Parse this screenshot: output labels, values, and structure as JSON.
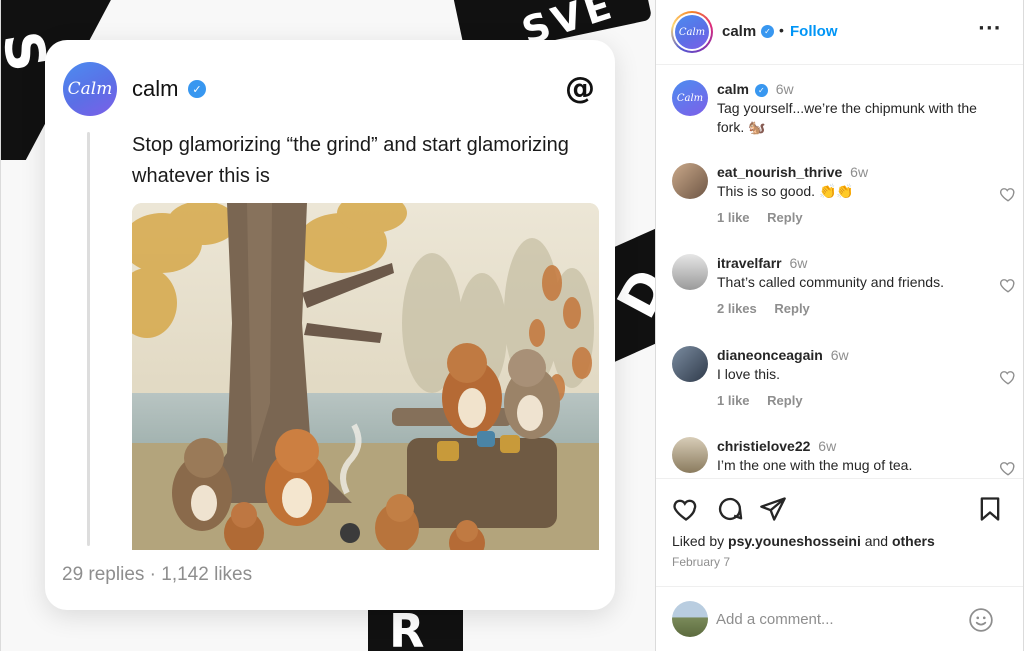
{
  "threads_card": {
    "avatar_text": "Calm",
    "username": "calm",
    "post_text": "Stop glamorizing “the grind” and start glamorizing whatever this is",
    "stats": "29 replies · 1,142 likes",
    "threads_icon": "threads-logo-icon",
    "image": "chipmunks-picnic-illustration"
  },
  "instagram": {
    "header": {
      "avatar_text": "Calm",
      "username": "calm",
      "separator": "•",
      "follow_label": "Follow",
      "more_label": "···"
    },
    "comments": [
      {
        "avatar_text": "Calm",
        "username": "calm",
        "time": "6w",
        "text": "Tag yourself...we’re the chipmunk with the fork. 🐿️",
        "likes": "",
        "reply": ""
      },
      {
        "username": "eat_nourish_thrive",
        "time": "6w",
        "text": "This is so good. 👏👏",
        "likes": "1 like",
        "reply": "Reply"
      },
      {
        "username": "itravelfarr",
        "time": "6w",
        "text": "That’s called community and friends.",
        "likes": "2 likes",
        "reply": "Reply"
      },
      {
        "username": "dianeonceagain",
        "time": "6w",
        "text": "I love this.",
        "likes": "1 like",
        "reply": "Reply"
      },
      {
        "username": "christielove22",
        "time": "6w",
        "text": "I’m the one with the mug of tea.",
        "likes": "",
        "reply": ""
      }
    ],
    "liked_by": {
      "prefix": "Liked by",
      "user": "psy.youneshosseini",
      "and": "and",
      "others": "others"
    },
    "date": "February 7",
    "add_comment": {
      "placeholder": "Add a comment..."
    }
  },
  "colors": {
    "accent_blue": "#0095f6",
    "verified_blue": "#3897f0",
    "muted_text": "#8e8e8e"
  }
}
